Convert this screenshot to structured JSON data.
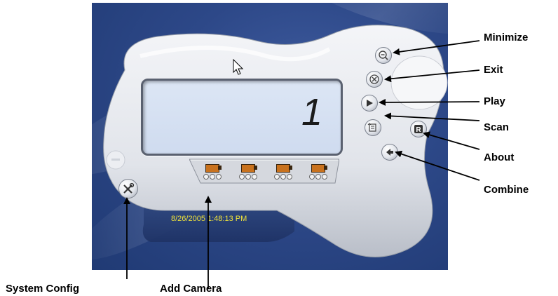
{
  "display": {
    "channel_number": "1"
  },
  "status": {
    "datetime": "8/26/2005 1:48:13 PM"
  },
  "callouts": {
    "minimize": "Minimize",
    "exit": "Exit",
    "play": "Play",
    "scan": "Scan",
    "about": "About",
    "combine": "Combine",
    "system_config": "System Config",
    "add_camera": "Add Camera"
  },
  "cameras": [
    {
      "slot": 1
    },
    {
      "slot": 2
    },
    {
      "slot": 3
    },
    {
      "slot": 4
    }
  ],
  "icons": {
    "minimize": "zoom-out-icon",
    "exit": "close-circle-icon",
    "play": "play-icon",
    "scan": "scan-icon",
    "about": "about-icon",
    "combine": "back-arrow-icon",
    "system_config": "tools-icon",
    "unused_top_left": "minus-icon"
  },
  "colors": {
    "desktop": "#2d4888",
    "body": "#e4e7ec",
    "screen": "#d6e0f2",
    "clock_text": "#f0e33a",
    "camera": "#c9721d"
  }
}
